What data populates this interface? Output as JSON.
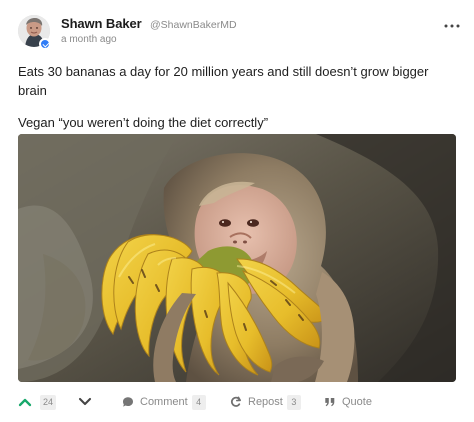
{
  "post": {
    "author": {
      "name": "Shawn Baker",
      "handle": "@ShawnBakerMD",
      "time": "a month ago",
      "verified": true
    },
    "content": {
      "line1": "Eats 30 bananas a day for 20 million years and still doesn’t grow bigger brain",
      "line2": "Vegan “you weren’t doing the diet correctly”"
    },
    "media": {
      "subject": "monkey-with-bananas"
    },
    "actions": {
      "upvote_count": "24",
      "comment_label": "Comment",
      "comment_count": "4",
      "repost_label": "Repost",
      "repost_count": "3",
      "quote_label": "Quote"
    }
  },
  "colors": {
    "accent_green": "#18a86b",
    "muted_text": "#8a8a8a",
    "verified_blue": "#2f7cf6"
  }
}
